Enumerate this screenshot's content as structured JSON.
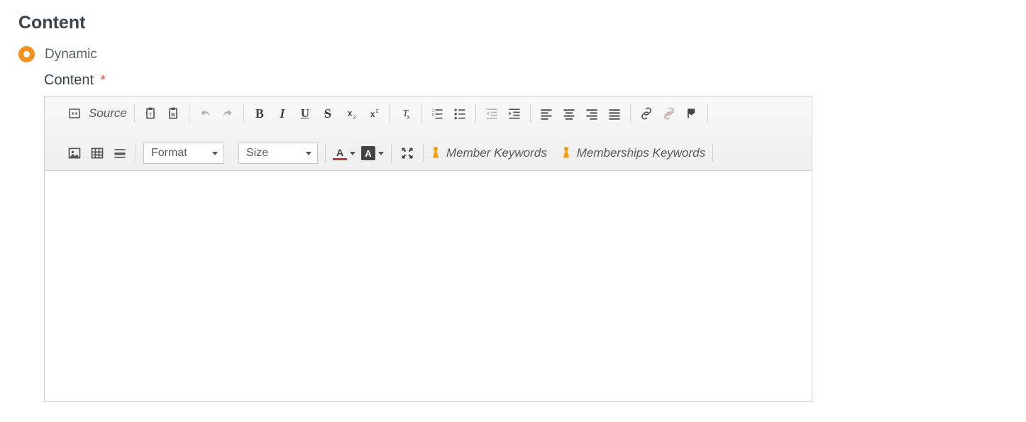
{
  "section": {
    "heading": "Content"
  },
  "contentType": {
    "selected_label": "Dynamic"
  },
  "field": {
    "label": "Content",
    "required_marker": "*"
  },
  "toolbar": {
    "source_label": "Source",
    "format_label": "Format",
    "size_label": "Size",
    "member_keywords_label": "Member Keywords",
    "memberships_keywords_label": "Memberships Keywords"
  },
  "icons": {
    "source": "source-code",
    "paste_text": "paste-plain-text",
    "paste_word": "paste-from-word",
    "undo": "undo",
    "redo": "redo",
    "bold": "bold",
    "italic": "italic",
    "underline": "underline",
    "strike": "strikethrough",
    "subscript": "subscript",
    "superscript": "superscript",
    "remove_format": "remove-format",
    "num_list": "numbered-list",
    "bul_list": "bulleted-list",
    "outdent": "decrease-indent",
    "indent": "increase-indent",
    "align_left": "align-left",
    "align_center": "align-center",
    "align_right": "align-right",
    "align_justify": "align-justify",
    "link": "link",
    "unlink": "unlink",
    "anchor_flag": "anchor",
    "image": "image",
    "table": "table",
    "hr": "horizontal-rule",
    "text_color": "text-color",
    "bg_color": "background-color",
    "maximize": "maximize",
    "keyword": "keyword-marker"
  }
}
